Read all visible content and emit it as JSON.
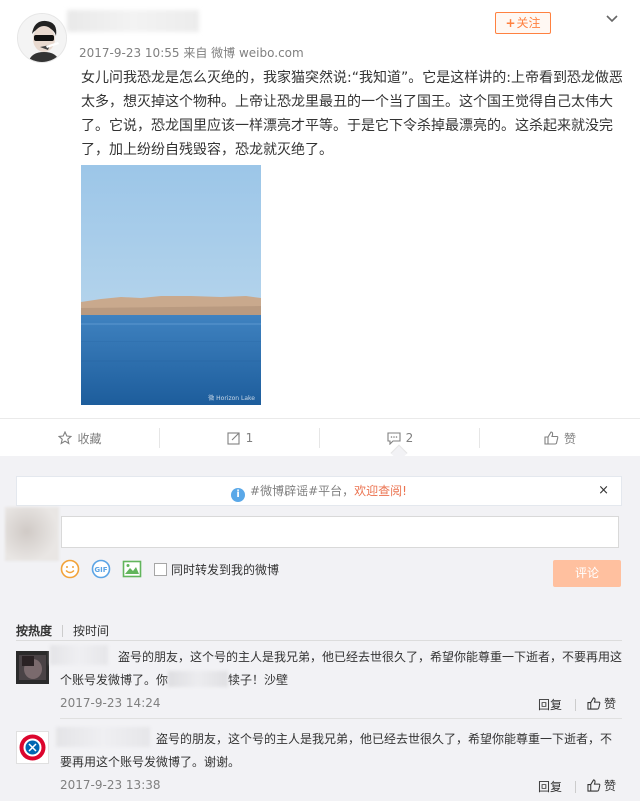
{
  "post": {
    "author_name": "",
    "timestamp": "2017-9-23 10:55",
    "from_label": "来自",
    "source": "微博 weibo.com",
    "follow_label": "关注",
    "follow_plus": "+",
    "text": "女儿问我恐龙是怎么灭绝的，我家猫突然说:“我知道”。它是这样讲的:上帝看到恐龙做恶太多，想灭掉这个物种。上帝让恐龙里最丑的一个当了国王。这个国王觉得自己太伟大了。它说，恐龙国里应该一样漂亮才平等。于是它下令杀掉最漂亮的。这杀起来就没完了，加上纷纷自残毁容，恐龙就灭绝了。",
    "photo_watermark": "微 Horizon Lake"
  },
  "actions": {
    "favorite_label": "收藏",
    "repost_count": "1",
    "comment_count": "2",
    "like_label": "赞"
  },
  "notice": {
    "prefix": "#微博辟谣#平台，",
    "highlight": "欢迎查阅!",
    "close": "×",
    "info": "i"
  },
  "composer": {
    "placeholder": "",
    "sync_label": "同时转发到我的微博",
    "submit_label": "评论"
  },
  "sort": {
    "hot": "按热度",
    "time": "按时间"
  },
  "comments": [
    {
      "text_before": "盗号的朋友，这个号的主人是我兄弟，他已经去世很久了，希望你能尊重一下逝者，不要再用这个账号发微博了。你",
      "text_after": "犊子！沙壁",
      "date": "2017-9-23 14:24",
      "reply_label": "回复",
      "like_label": "赞"
    },
    {
      "text": "盗号的朋友，这个号的主人是我兄弟，他已经去世很久了，希望你能尊重一下逝者，不要再用这个账号发微博了。谢谢。",
      "date": "2017-9-23 13:38",
      "reply_label": "回复",
      "like_label": "赞"
    }
  ],
  "colors": {
    "accent_orange": "#ff8140",
    "highlight": "#eb7350",
    "muted_text": "#808080",
    "panel_bg": "#f2f2f5",
    "submit_disabled": "#ffc09f"
  },
  "icons": [
    "user-avatar",
    "chevron-down-icon",
    "star-icon",
    "repost-icon",
    "comment-icon",
    "thumbs-up-icon",
    "info-icon",
    "close-icon",
    "emoji-icon",
    "gif-icon",
    "image-icon",
    "checkbox"
  ]
}
